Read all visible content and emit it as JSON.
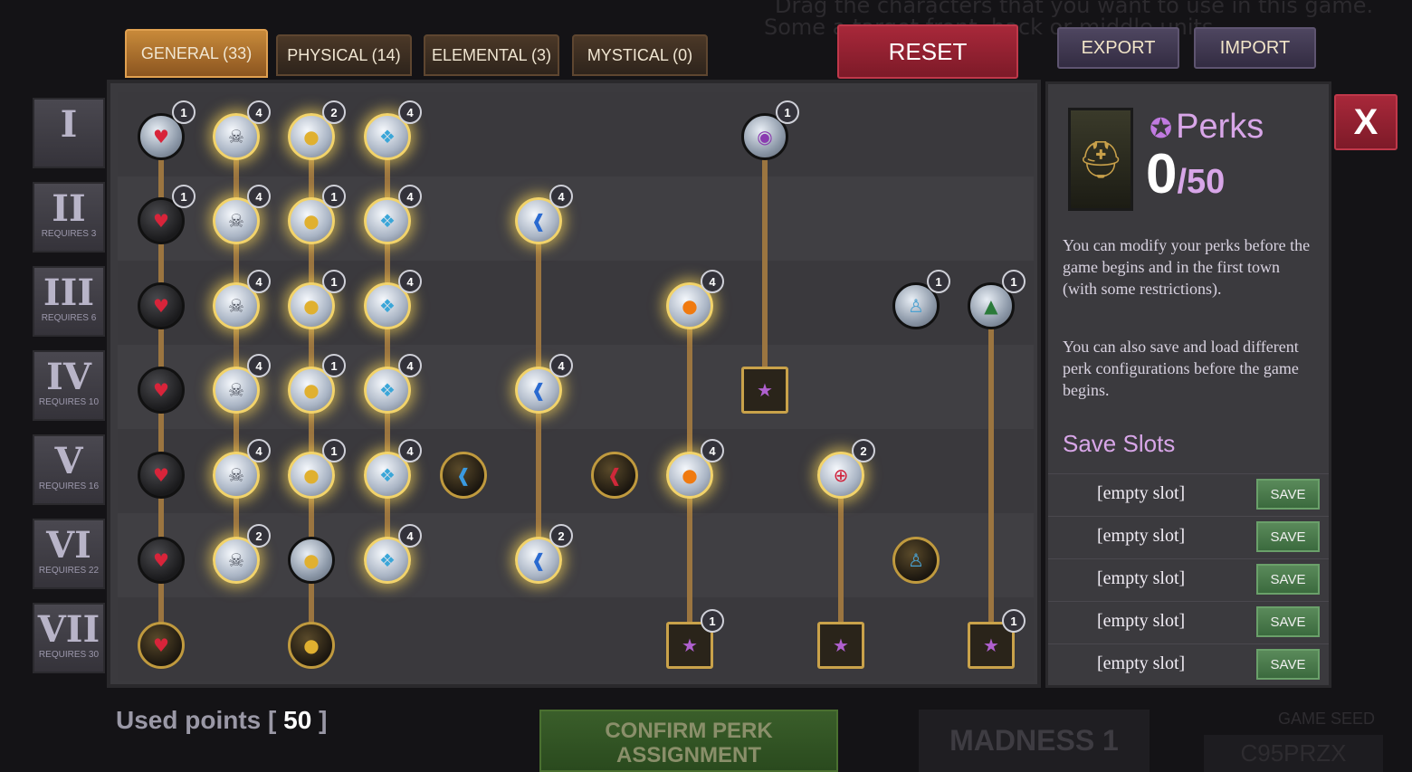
{
  "background": {
    "hint_line1": "Drag the characters that you want to use in this game.",
    "hint_line2": "Some a                          target front, back or middle units."
  },
  "tabs": [
    {
      "label": "GENERAL (33)",
      "active": true
    },
    {
      "label": "PHYSICAL (14)",
      "active": false
    },
    {
      "label": "ELEMENTAL (3)",
      "active": false
    },
    {
      "label": "MYSTICAL (0)",
      "active": false
    }
  ],
  "buttons": {
    "reset": "RESET",
    "export": "EXPORT",
    "import": "IMPORT",
    "close": "X"
  },
  "tiers": [
    {
      "numeral": "I",
      "requires": ""
    },
    {
      "numeral": "II",
      "requires": "REQUIRES 3"
    },
    {
      "numeral": "III",
      "requires": "REQUIRES 6"
    },
    {
      "numeral": "IV",
      "requires": "REQUIRES 10"
    },
    {
      "numeral": "V",
      "requires": "REQUIRES 16"
    },
    {
      "numeral": "VI",
      "requires": "REQUIRES 22"
    },
    {
      "numeral": "VII",
      "requires": "REQUIRES 30"
    }
  ],
  "perks_panel": {
    "title": "Perks",
    "points_current": "0",
    "points_total": "/50",
    "desc1": "You can modify your perks before the game begins and in the first town (with some restrictions).",
    "desc2": "You can also save and load different perk configurations before the game begins.",
    "save_title": "Save Slots",
    "slots": [
      {
        "label": "[empty slot]",
        "button": "SAVE"
      },
      {
        "label": "[empty slot]",
        "button": "SAVE"
      },
      {
        "label": "[empty slot]",
        "button": "SAVE"
      },
      {
        "label": "[empty slot]",
        "button": "SAVE"
      },
      {
        "label": "[empty slot]",
        "button": "SAVE"
      }
    ]
  },
  "footer": {
    "used_label": "Used points [",
    "used_value": "50",
    "used_close": "]",
    "confirm_line1": "CONFIRM PERK",
    "confirm_line2": "ASSIGNMENT",
    "madness": "MADNESS 1",
    "seed_label": "GAME SEED",
    "seed_value": "C95PRZX"
  },
  "nodes": [
    {
      "id": "n1",
      "icon": "heart-icon",
      "glyph": "♥",
      "badge": "1"
    },
    {
      "id": "n2",
      "icon": "skull-crossbones-icon",
      "glyph": "☠",
      "badge": "4"
    },
    {
      "id": "n3",
      "icon": "gold-coins-icon",
      "glyph": "●",
      "badge": "2"
    },
    {
      "id": "n4",
      "icon": "crystal-icon",
      "glyph": "❖",
      "badge": "4"
    },
    {
      "id": "n5",
      "icon": "eye-icon",
      "glyph": "◉",
      "badge": "1"
    },
    {
      "id": "n6",
      "icon": "heart-icon",
      "glyph": "♥",
      "badge": "1"
    },
    {
      "id": "n7",
      "icon": "skull-crossbones-icon",
      "glyph": "☠",
      "badge": "4"
    },
    {
      "id": "n8",
      "icon": "gold-coins-icon",
      "glyph": "●",
      "badge": "1"
    },
    {
      "id": "n9",
      "icon": "crystal-icon",
      "glyph": "❖",
      "badge": "4"
    },
    {
      "id": "n10",
      "icon": "boot-icon",
      "glyph": "❰",
      "badge": "4"
    },
    {
      "id": "n11",
      "icon": "heart-icon",
      "glyph": "♥",
      "badge": ""
    },
    {
      "id": "n12",
      "icon": "skull-crossbones-icon",
      "glyph": "☠",
      "badge": "4"
    },
    {
      "id": "n13",
      "icon": "gold-coins-icon",
      "glyph": "●",
      "badge": "1"
    },
    {
      "id": "n14",
      "icon": "crystal-icon",
      "glyph": "❖",
      "badge": "4"
    },
    {
      "id": "n15",
      "icon": "fire-orb-icon",
      "glyph": "●",
      "badge": "4"
    },
    {
      "id": "n16",
      "icon": "person-icon",
      "glyph": "♙",
      "badge": "1"
    },
    {
      "id": "n17",
      "icon": "hood-icon",
      "glyph": "▲",
      "badge": "1"
    },
    {
      "id": "n18",
      "icon": "heart-icon",
      "glyph": "♥",
      "badge": ""
    },
    {
      "id": "n19",
      "icon": "skull-crossbones-icon",
      "glyph": "☠",
      "badge": "4"
    },
    {
      "id": "n20",
      "icon": "gold-coins-icon",
      "glyph": "●",
      "badge": "1"
    },
    {
      "id": "n21",
      "icon": "crystal-icon",
      "glyph": "❖",
      "badge": "4"
    },
    {
      "id": "n22",
      "icon": "boot-icon",
      "glyph": "❰",
      "badge": "4"
    },
    {
      "id": "n23",
      "icon": "star-square-icon",
      "glyph": "★",
      "badge": ""
    },
    {
      "id": "n24",
      "icon": "heart-icon",
      "glyph": "♥",
      "badge": ""
    },
    {
      "id": "n25",
      "icon": "skull-crossbones-icon",
      "glyph": "☠",
      "badge": "4"
    },
    {
      "id": "n26",
      "icon": "gold-coins-icon",
      "glyph": "●",
      "badge": "1"
    },
    {
      "id": "n27",
      "icon": "crystal-icon",
      "glyph": "❖",
      "badge": "4"
    },
    {
      "id": "n28",
      "icon": "blue-boot-icon",
      "glyph": "❰",
      "badge": ""
    },
    {
      "id": "n29",
      "icon": "red-boot-icon",
      "glyph": "❰",
      "badge": ""
    },
    {
      "id": "n30",
      "icon": "fire-orb-icon",
      "glyph": "●",
      "badge": "4"
    },
    {
      "id": "n31",
      "icon": "crosshair-icon",
      "glyph": "⊕",
      "badge": "2"
    },
    {
      "id": "n32",
      "icon": "heart-icon",
      "glyph": "♥",
      "badge": ""
    },
    {
      "id": "n33",
      "icon": "skull-crossbones-icon",
      "glyph": "☠",
      "badge": "2"
    },
    {
      "id": "n34",
      "icon": "gold-coins-icon",
      "glyph": "●",
      "badge": ""
    },
    {
      "id": "n35",
      "icon": "crystal-icon",
      "glyph": "❖",
      "badge": "4"
    },
    {
      "id": "n36",
      "icon": "boot-icon",
      "glyph": "❰",
      "badge": "2"
    },
    {
      "id": "n37",
      "icon": "person-icon",
      "glyph": "♙",
      "badge": ""
    },
    {
      "id": "n38",
      "icon": "heart-icon",
      "glyph": "♥",
      "badge": ""
    },
    {
      "id": "n39",
      "icon": "gold-coins-icon",
      "glyph": "●",
      "badge": ""
    },
    {
      "id": "n40",
      "icon": "star-square-icon",
      "glyph": "★",
      "badge": "1"
    },
    {
      "id": "n41",
      "icon": "star-square-icon",
      "glyph": "★",
      "badge": ""
    },
    {
      "id": "n42",
      "icon": "star-square-icon",
      "glyph": "★",
      "badge": "1"
    }
  ],
  "colors": {
    "accent_gold": "#f2d36a",
    "perk_purple": "#d8a6e8",
    "reset_red": "#a8283a",
    "save_green": "#3b6a3e"
  }
}
